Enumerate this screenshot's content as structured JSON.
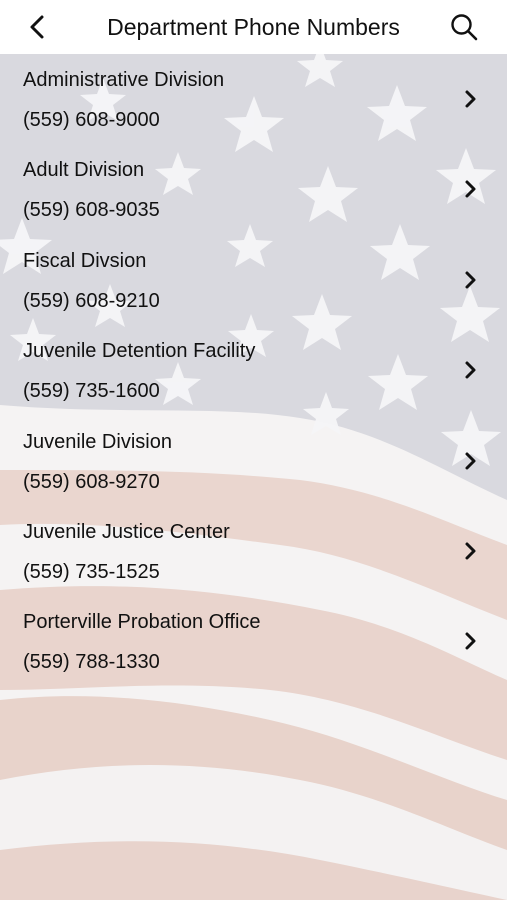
{
  "header": {
    "title": "Department Phone Numbers",
    "back_icon": "chevron-left-icon",
    "search_icon": "search-icon"
  },
  "departments": [
    {
      "name": "Administrative Division",
      "phone": "(559) 608-9000"
    },
    {
      "name": "Adult Division",
      "phone": "(559) 608-9035"
    },
    {
      "name": "Fiscal Divsion",
      "phone": "(559) 608-9210"
    },
    {
      "name": "Juvenile Detention Facility",
      "phone": "(559) 735-1600"
    },
    {
      "name": "Juvenile Division",
      "phone": "(559) 608-9270"
    },
    {
      "name": "Juvenile Justice Center",
      "phone": "(559) 735-1525"
    },
    {
      "name": "Porterville Probation Office",
      "phone": "(559) 788-1330"
    }
  ],
  "colors": {
    "canton": "#d8d8de",
    "stripe_red": "#ecd5cc",
    "stripe_white": "#f6f5f5"
  }
}
